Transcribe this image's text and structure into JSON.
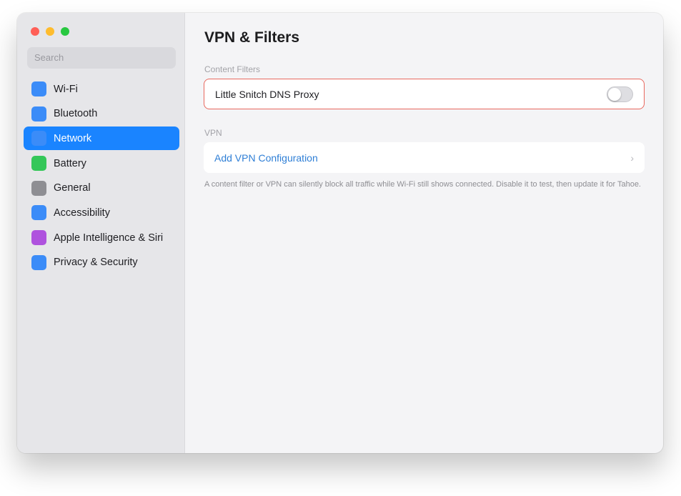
{
  "window": {
    "traffic_lights": {
      "close_color": "#ff5f57",
      "minimize_color": "#febc2e",
      "zoom_color": "#28c840"
    }
  },
  "sidebar": {
    "search_placeholder": "Search",
    "selected_index": 2,
    "items": [
      {
        "label": "Wi-Fi",
        "icon": "wifi-icon",
        "color": "#3b8cf8"
      },
      {
        "label": "Bluetooth",
        "icon": "bluetooth-icon",
        "color": "#3b8cf8"
      },
      {
        "label": "Network",
        "icon": "network-icon",
        "color": "#3b8cf8"
      },
      {
        "label": "Battery",
        "icon": "battery-icon",
        "color": "#34c759"
      },
      {
        "label": "General",
        "icon": "gear-icon",
        "color": "#8e8e93"
      },
      {
        "label": "Accessibility",
        "icon": "accessibility-icon",
        "color": "#3b8cf8"
      },
      {
        "label": "Apple Intelligence & Siri",
        "icon": "siri-icon",
        "color": "#af52de"
      },
      {
        "label": "Privacy & Security",
        "icon": "privacy-icon",
        "color": "#3b8cf8"
      }
    ]
  },
  "main": {
    "title": "VPN & Filters",
    "content_filters": {
      "section_label": "Content Filters",
      "item_label": "Little Snitch DNS Proxy",
      "toggle_on": false,
      "highlight_color": "#e8685e"
    },
    "vpn": {
      "section_label": "VPN",
      "add_label": "Add VPN Configuration",
      "chevron": "›"
    },
    "footnote": "A content filter or VPN can silently block all traffic while Wi-Fi still shows connected. Disable it to test, then update it for Tahoe."
  }
}
